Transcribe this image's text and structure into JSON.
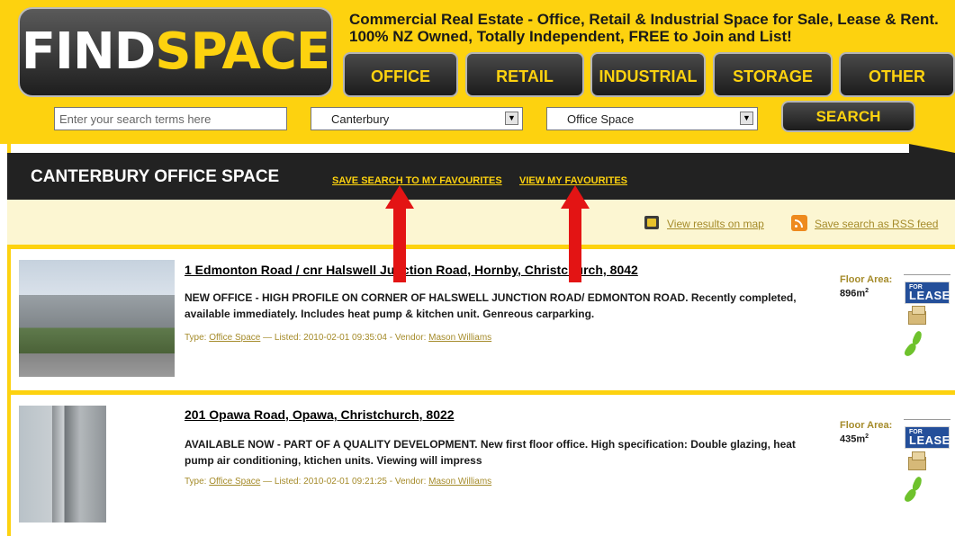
{
  "logo": {
    "part1": "FIND",
    "part2": "SPACE"
  },
  "tagline": "Commercial Real Estate - Office, Retail & Industrial Space for Sale, Lease & Rent. 100% NZ Owned, Totally Independent, FREE to Join and List!",
  "nav": [
    {
      "label": "OFFICE"
    },
    {
      "label": "RETAIL"
    },
    {
      "label": "INDUSTRIAL"
    },
    {
      "label": "STORAGE"
    },
    {
      "label": "OTHER"
    }
  ],
  "search": {
    "placeholder": "Enter your search terms here",
    "region": "Canterbury",
    "type": "Office Space",
    "button_label": "SEARCH"
  },
  "page_header": {
    "title": "CANTERBURY OFFICE SPACE",
    "save_link": "SAVE SEARCH TO MY FAVOURITES",
    "view_link": "VIEW MY FAVOURITES"
  },
  "tools": {
    "map_link": "View results on map",
    "rss_link": "Save search as RSS feed"
  },
  "listings": [
    {
      "title": "1 Edmonton Road / cnr Halswell Junction Road, Hornby, Christchurch, 8042",
      "description": "NEW OFFICE - HIGH PROFILE ON CORNER OF HALSWELL JUNCTION ROAD/ EDMONTON ROAD. Recently completed, available immediately. Includes heat pump & kitchen unit. Genreous carparking.",
      "type_label": "Type:",
      "type": "Office Space",
      "listed": "— Listed: 2010-02-01 09:35:04 - Vendor:",
      "vendor": "Mason Williams",
      "floor_area_label": "Floor Area:",
      "floor_area": "896m",
      "unit_sup": "2",
      "badge_small": "FOR",
      "badge_big": "LEASE"
    },
    {
      "title": "201 Opawa Road, Opawa, Christchurch, 8022",
      "description": "AVAILABLE NOW - PART OF A QUALITY DEVELOPMENT. New first floor office. High specification: Double glazing, heat pump air conditioning, ktichen units. Viewing will impress",
      "type_label": "Type:",
      "type": "Office Space",
      "listed": "— Listed: 2010-02-01 09:21:25 - Vendor:",
      "vendor": "Mason Williams",
      "floor_area_label": "Floor Area:",
      "floor_area": "435m",
      "unit_sup": "2",
      "badge_small": "FOR",
      "badge_big": "LEASE"
    }
  ],
  "colors": {
    "brand_yellow": "#fdd20f",
    "dark": "#222222",
    "link_gold": "#a58b2a",
    "arrow_red": "#e31414",
    "lease_blue": "#244f9a"
  },
  "icons": [
    "map-icon",
    "rss-icon",
    "dropdown-arrow-icon",
    "box-icon",
    "nz-map-icon"
  ]
}
